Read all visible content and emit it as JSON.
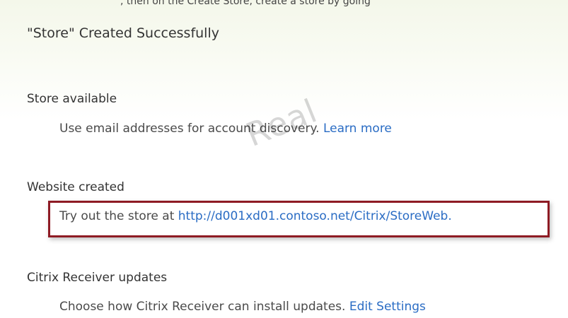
{
  "page": {
    "top_fragment": ", then on the Create Store, create a store by going",
    "title": "\"Store\" Created Successfully"
  },
  "sections": [
    {
      "heading": "Store available",
      "text": "Use email addresses for account discovery. ",
      "link": "Learn more"
    },
    {
      "heading": "Website created",
      "text": "Try out the store at ",
      "link": "http://d001xd01.contoso.net/Citrix/StoreWeb.",
      "highlighted": true
    },
    {
      "heading": "Citrix Receiver updates",
      "text": "Choose how Citrix Receiver can install updates. ",
      "link": "Edit Settings"
    }
  ],
  "watermark": "Real",
  "colors": {
    "link": "#2a6cc4",
    "highlight_border": "#8e1b24",
    "heading": "#333333"
  }
}
